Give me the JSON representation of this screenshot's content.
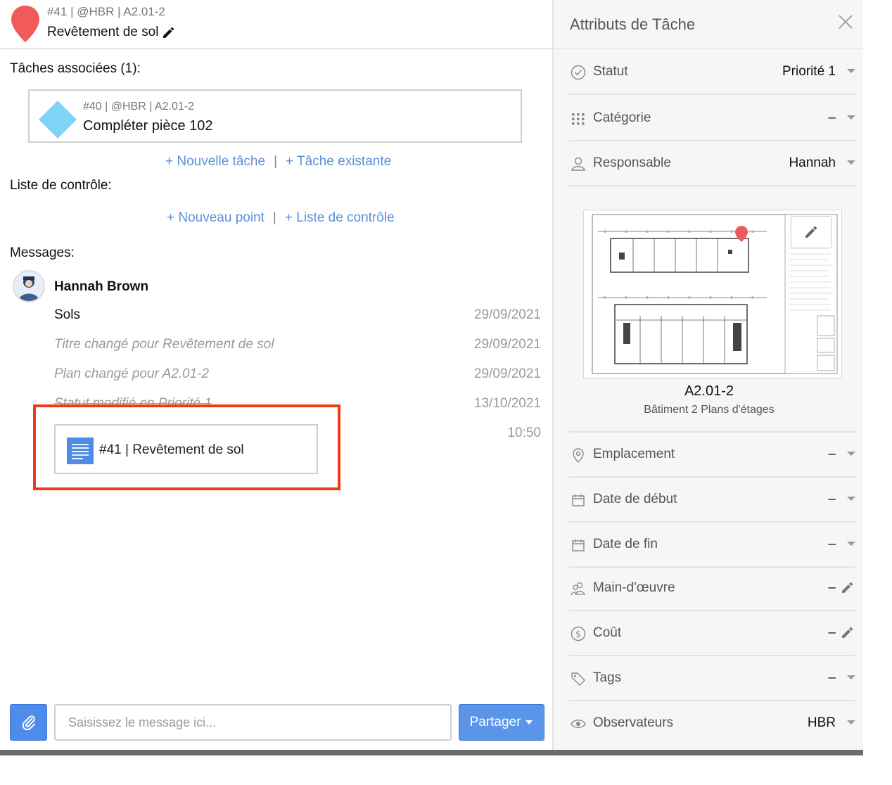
{
  "header": {
    "subtitle": "#41 | @HBR | A2.01-2",
    "title": "Revêtement de sol"
  },
  "related": {
    "label": "Tâches associées (1):",
    "task": {
      "subtitle": "#40 | @HBR | A2.01-2",
      "title": "Compléter pièce 102"
    },
    "new_task": "+ Nouvelle tâche",
    "separator": "|",
    "existing_task": "+ Tâche existante"
  },
  "checklist": {
    "label": "Liste de contrôle:",
    "new_point": "+ Nouveau point",
    "separator": "|",
    "checklist_link": "+ Liste de contrôle"
  },
  "messages": {
    "label": "Messages:",
    "author": "Hannah Brown",
    "items": [
      {
        "text": "Sols",
        "date": "29/09/2021"
      },
      {
        "text": "Titre changé pour Revêtement de sol",
        "date": "29/09/2021"
      },
      {
        "text": "Plan changé pour A2.01-2",
        "date": "29/09/2021"
      },
      {
        "text": "Statut modifié en Priorité 1",
        "date": "13/10/2021"
      }
    ],
    "attachment": {
      "label": "#41 | Revêtement de sol",
      "time": "10:50"
    }
  },
  "composer": {
    "placeholder": "Saisissez le message ici...",
    "share_label": "Partager"
  },
  "panel": {
    "title": "Attributs de Tâche",
    "attributes": [
      {
        "label": "Statut",
        "value": "Priorité 1",
        "icon": "check-circle-icon"
      },
      {
        "label": "Catégorie",
        "value": "–",
        "icon": "grid-dots-icon"
      },
      {
        "label": "Responsable",
        "value": "Hannah",
        "icon": "user-icon"
      },
      {
        "label": "Emplacement",
        "value": "–",
        "icon": "location-pin-icon"
      },
      {
        "label": "Date de début",
        "value": "–",
        "icon": "calendar-icon"
      },
      {
        "label": "Date de fin",
        "value": "–",
        "icon": "calendar-icon"
      },
      {
        "label": "Main-d'œuvre",
        "value": "–",
        "icon": "people-icon"
      },
      {
        "label": "Coût",
        "value": "–",
        "icon": "dollar-icon"
      },
      {
        "label": "Tags",
        "value": "–",
        "icon": "tag-icon"
      },
      {
        "label": "Observateurs",
        "value": "HBR",
        "icon": "eye-icon"
      }
    ],
    "plan": {
      "name": "A2.01-2",
      "description": "Bâtiment 2 Plans d'étages"
    }
  },
  "colors": {
    "accent": "#4f8be8",
    "link": "#5b8fd9",
    "pin": "#f15a5a",
    "highlight": "#f03a17"
  }
}
